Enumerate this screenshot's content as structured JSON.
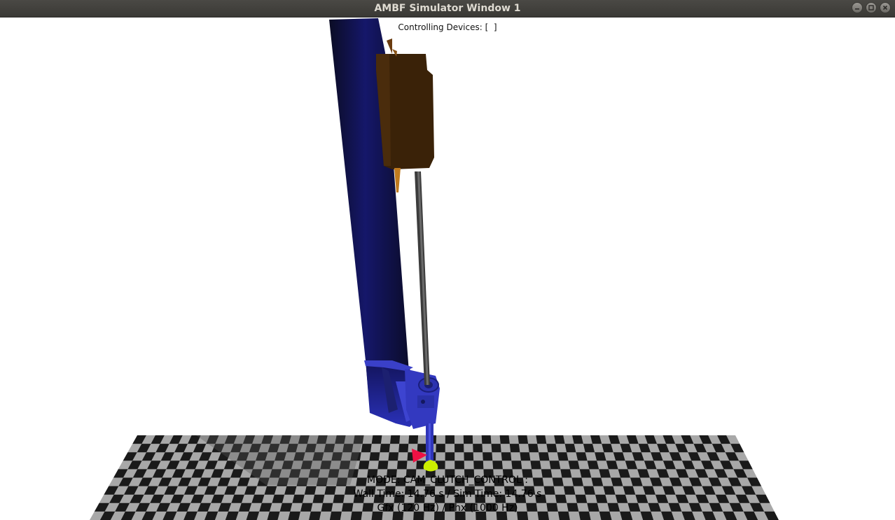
{
  "window": {
    "title": "AMBF Simulator Window 1",
    "controls": {
      "minimize_icon": "minimize-icon",
      "maximize_icon": "maximize-icon",
      "close_icon": "close-icon"
    }
  },
  "overlay": {
    "controlling_devices": "Controlling Devices: [  ]",
    "mode": "MODE: CAM_CLUTCH_CONTROL :",
    "time": "Wall Time: 14.76 s / Sim Time: 14.76 s",
    "rates": "Gfx (120 Hz) / Phx (1000 Hz)"
  },
  "colors": {
    "titlebar": "#3f3e3a",
    "title_text": "#dfdbd2",
    "checker_dark": "#1a1a1a",
    "checker_light": "#a8a8a8",
    "robot_blue": "#2a2fa8",
    "robot_dark_blue": "#0d0e2e",
    "brown_block": "#3a2208",
    "rod": "#3a3a3a",
    "red_marker": "#ee1144",
    "yellow_marker": "#ccee00"
  }
}
